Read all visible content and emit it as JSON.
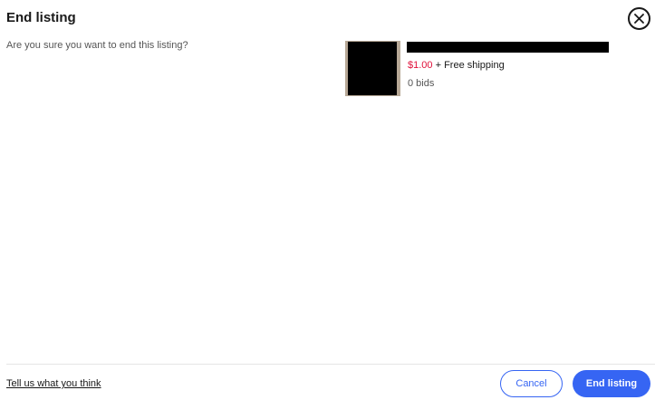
{
  "dialog": {
    "title": "End listing",
    "question": "Are you sure you want to end this listing?"
  },
  "listing": {
    "price": "$1.00",
    "shipping": "+ Free shipping",
    "bids": "0 bids"
  },
  "footer": {
    "feedback_link": "Tell us what you think",
    "cancel_label": "Cancel",
    "end_label": "End listing"
  },
  "icons": {
    "close": "close-icon"
  },
  "colors": {
    "accent": "#3665f3",
    "price": "#e0103a"
  }
}
